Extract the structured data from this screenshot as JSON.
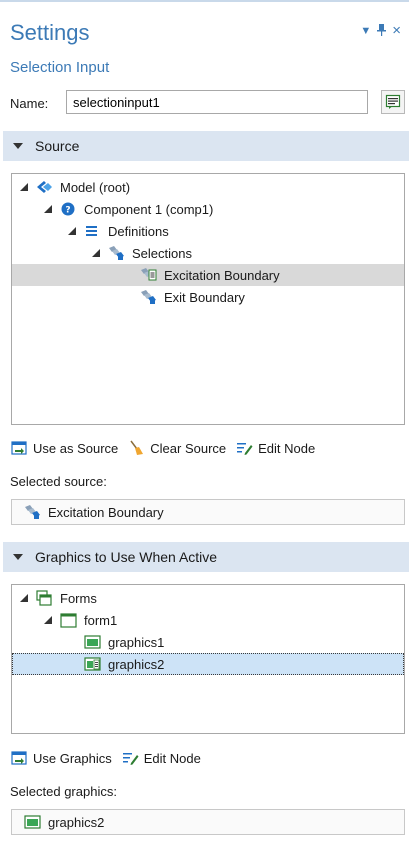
{
  "header": {
    "title": "Settings",
    "subtitle": "Selection Input",
    "controls": [
      "▾",
      "⊥",
      "×"
    ]
  },
  "name_field": {
    "label": "Name:",
    "value": "selectioninput1"
  },
  "source_section": {
    "title": "Source",
    "tree": [
      {
        "label": "Model (root)",
        "icon": "model-root-icon",
        "level": 0
      },
      {
        "label": "Component 1 (comp1)",
        "icon": "component-icon",
        "level": 1
      },
      {
        "label": "Definitions",
        "icon": "definitions-icon",
        "level": 2
      },
      {
        "label": "Selections",
        "icon": "selections-icon",
        "level": 3
      },
      {
        "label": "Excitation Boundary",
        "icon": "selection-node-icon",
        "level": 4,
        "selected": true
      },
      {
        "label": "Exit Boundary",
        "icon": "selection-icon",
        "level": 4
      }
    ],
    "toolbar": {
      "use_as_source": "Use as Source",
      "clear_source": "Clear Source",
      "edit_node": "Edit Node"
    },
    "selected_label": "Selected source:",
    "selected_value": "Excitation Boundary"
  },
  "graphics_section": {
    "title": "Graphics to Use When Active",
    "tree": [
      {
        "label": "Forms",
        "icon": "forms-icon",
        "level": 0
      },
      {
        "label": "form1",
        "icon": "form-icon",
        "level": 1
      },
      {
        "label": "graphics1",
        "icon": "graphics-icon",
        "level": 2
      },
      {
        "label": "graphics2",
        "icon": "graphics-node-icon",
        "level": 2,
        "selected": true
      }
    ],
    "toolbar": {
      "use_graphics": "Use Graphics",
      "edit_node": "Edit Node"
    },
    "selected_label": "Selected graphics:",
    "selected_value": "graphics2"
  },
  "colors": {
    "accent": "#3c7ab6",
    "section_header_bg": "#dbe5f1",
    "selected_gray": "#d9d9d9",
    "selected_blue": "#cde3f7"
  }
}
